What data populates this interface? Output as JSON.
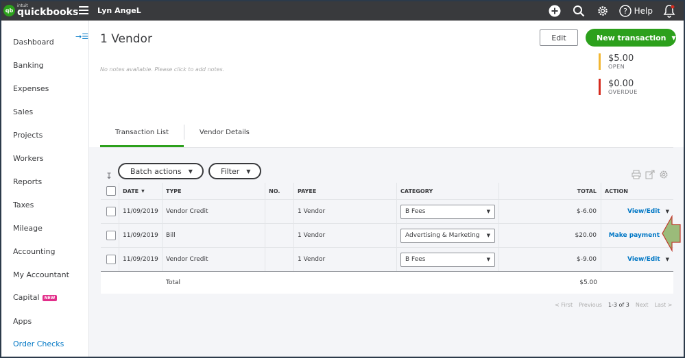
{
  "brand": {
    "intuit": "intuit",
    "name": "quickbooks",
    "logo": "qb",
    "green": "#2ca01c"
  },
  "topbar": {
    "company": "Lyn AngeL",
    "help_label": "Help"
  },
  "sidebar": {
    "items": [
      "Dashboard",
      "Banking",
      "Expenses",
      "Sales",
      "Projects",
      "Workers",
      "Reports",
      "Taxes",
      "Mileage",
      "Accounting",
      "My Accountant",
      "Capital",
      "Apps",
      "Order Checks"
    ],
    "capital_badge": "NEW"
  },
  "header": {
    "title": "1 Vendor",
    "notes_placeholder": "No notes available. Please click to add notes.",
    "edit_label": "Edit",
    "new_txn_label": "New transaction",
    "open": {
      "amount": "$5.00",
      "label": "OPEN",
      "color": "#f2b632"
    },
    "overdue": {
      "amount": "$0.00",
      "label": "OVERDUE",
      "color": "#d52b1e"
    }
  },
  "tabs": [
    "Transaction List",
    "Vendor Details"
  ],
  "toolbar": {
    "batch_label": "Batch actions",
    "filter_label": "Filter"
  },
  "table": {
    "headers": {
      "date": "DATE",
      "type": "TYPE",
      "no": "NO.",
      "payee": "PAYEE",
      "category": "CATEGORY",
      "total": "TOTAL",
      "action": "ACTION"
    },
    "rows": [
      {
        "date": "11/09/2019",
        "type": "Vendor Credit",
        "no": "",
        "payee": "1 Vendor",
        "category": "B Fees",
        "total": "$-6.00",
        "action": "View/Edit"
      },
      {
        "date": "11/09/2019",
        "type": "Bill",
        "no": "",
        "payee": "1 Vendor",
        "category": "Advertising & Marketing",
        "total": "$20.00",
        "action": "Make payment"
      },
      {
        "date": "11/09/2019",
        "type": "Vendor Credit",
        "no": "",
        "payee": "1 Vendor",
        "category": "B Fees",
        "total": "$-9.00",
        "action": "View/Edit"
      }
    ],
    "total_label": "Total",
    "total_value": "$5.00"
  },
  "pager": {
    "first": "< First",
    "previous": "Previous",
    "current": "1-3 of 3",
    "next": "Next",
    "last": "Last >"
  }
}
